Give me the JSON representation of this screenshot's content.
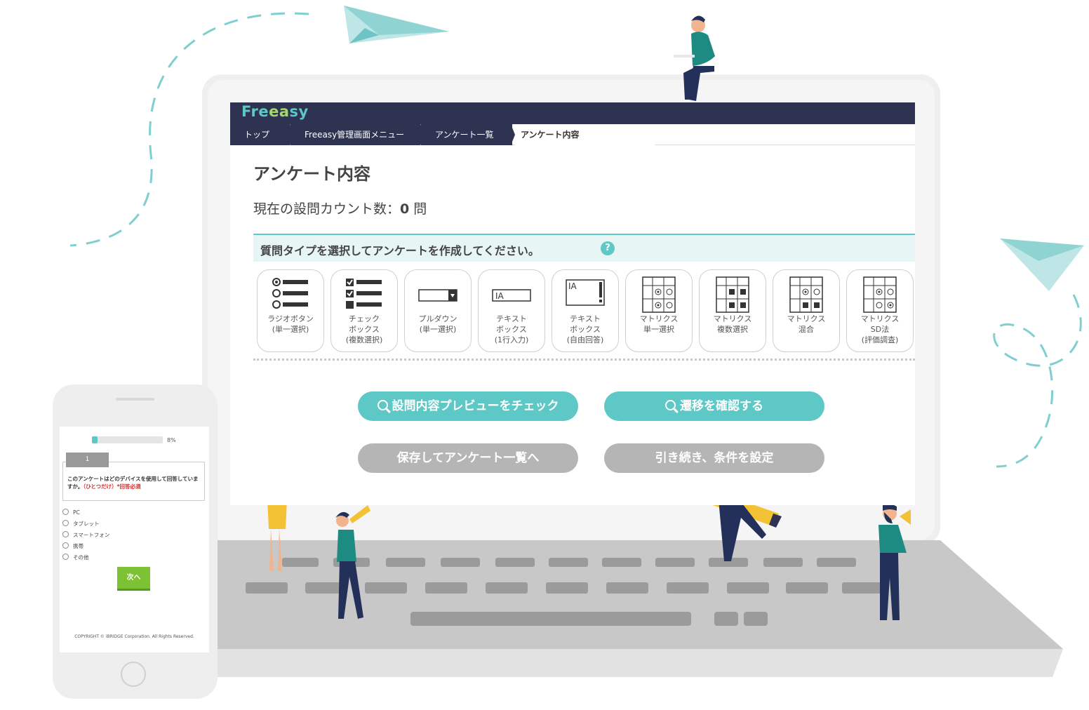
{
  "app": {
    "logo": "Freeasy",
    "breadcrumbs": [
      "トップ",
      "Freeasy管理画面メニュー",
      "アンケート一覧",
      "アンケート内容"
    ],
    "page_title": "アンケート内容",
    "count_prefix": "現在の設問カウント数：",
    "count_value": "0",
    "count_suffix": " 問",
    "question_type_prompt": "質問タイプを選択してアンケートを作成してください。",
    "help_icon": "?",
    "question_types": [
      {
        "line1": "ラジオボタン",
        "line2": "(単一選択)",
        "icon": "radio-list-icon"
      },
      {
        "line1": "チェック",
        "line2": "ボックス",
        "line3": "(複数選択)",
        "icon": "checkbox-list-icon"
      },
      {
        "line1": "プルダウン",
        "line2": "(単一選択)",
        "icon": "dropdown-icon"
      },
      {
        "line1": "テキスト",
        "line2": "ボックス",
        "line3": "(1行入力)",
        "icon": "textbox-single-icon"
      },
      {
        "line1": "テキスト",
        "line2": "ボックス",
        "line3": "(自由回答)",
        "icon": "textbox-multi-icon"
      },
      {
        "line1": "マトリクス",
        "line2": "単一選択",
        "icon": "matrix-single-icon"
      },
      {
        "line1": "マトリクス",
        "line2": "複数選択",
        "icon": "matrix-multi-icon"
      },
      {
        "line1": "マトリクス",
        "line2": "混合",
        "icon": "matrix-mixed-icon"
      },
      {
        "line1": "マトリクス",
        "line2": "SD法",
        "line3": "(評価調査)",
        "icon": "matrix-sd-icon"
      }
    ],
    "buttons": {
      "preview": "設問内容プレビューをチェック",
      "transition": "遷移を確認する",
      "save": "保存してアンケート一覧へ",
      "conditions": "引き続き、条件を設定"
    },
    "colors": {
      "navy": "#2d3350",
      "teal": "#5ec8c6",
      "gray_button": "#b5b5b5",
      "green": "#7cc234"
    }
  },
  "phone": {
    "progress_fraction": 0.08,
    "progress_label": "8%",
    "question_number": "1",
    "question_text": "このアンケートはどのデバイスを使用して回答していますか。",
    "question_note": "（ひとつだけ）*回答必須",
    "options": [
      "PC",
      "タブレット",
      "スマートフォン",
      "携帯",
      "その他"
    ],
    "next_button": "次へ",
    "copyright": "COPYRIGHT © iBRIDGE Corporation. All Rights Reserved."
  }
}
